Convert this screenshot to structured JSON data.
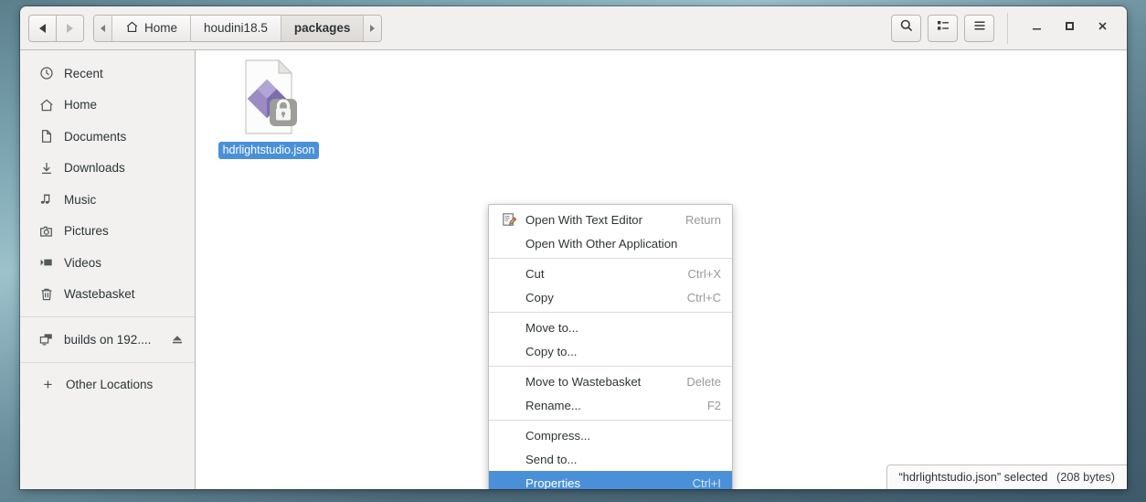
{
  "window": {
    "navigation": {
      "back_label": "Back",
      "back_enabled": "true",
      "forward_label": "Forward",
      "forward_enabled": "false"
    },
    "breadcrumb": {
      "left_arrow": "scroll-left",
      "right_arrow": "scroll-right",
      "items": [
        {
          "label": "Home",
          "icon": "home-icon",
          "current": "false"
        },
        {
          "label": "houdini18.5",
          "icon": "",
          "current": "false"
        },
        {
          "label": "packages",
          "icon": "",
          "current": "true"
        }
      ]
    },
    "toolbar_right": [
      {
        "name": "search-button",
        "icon": "search-icon"
      },
      {
        "name": "view-options-button",
        "icon": "list-view-icon"
      },
      {
        "name": "main-menu-button",
        "icon": "hamburger-icon"
      }
    ],
    "controls": [
      {
        "name": "minimize-button",
        "icon": "minimize-icon"
      },
      {
        "name": "maximize-button",
        "icon": "maximize-icon"
      },
      {
        "name": "close-button",
        "icon": "close-icon"
      }
    ]
  },
  "sidebar": {
    "items": [
      {
        "label": "Recent",
        "icon": "clock-icon"
      },
      {
        "label": "Home",
        "icon": "home-icon"
      },
      {
        "label": "Documents",
        "icon": "document-icon"
      },
      {
        "label": "Downloads",
        "icon": "download-icon"
      },
      {
        "label": "Music",
        "icon": "music-note-icon"
      },
      {
        "label": "Pictures",
        "icon": "camera-icon"
      },
      {
        "label": "Videos",
        "icon": "video-icon"
      },
      {
        "label": "Wastebasket",
        "icon": "trash-icon"
      }
    ],
    "mount": {
      "label": "builds on 192....",
      "icon": "network-drive-icon",
      "eject": "eject-icon"
    },
    "other_locations": {
      "label": "Other Locations",
      "icon": "plus-icon"
    }
  },
  "content": {
    "file": {
      "name": "hdrlightstudio.json",
      "icon": "json-file-icon",
      "badge": "lock-icon",
      "selected": "true"
    }
  },
  "context_menu": {
    "items": [
      {
        "label": "Open With Text Editor",
        "accel": "Return",
        "icon": "text-editor-icon",
        "selected": "false",
        "sep_after": "false"
      },
      {
        "label": "Open With Other Application",
        "accel": "",
        "icon": "",
        "selected": "false",
        "sep_after": "true"
      },
      {
        "label": "Cut",
        "accel": "Ctrl+X",
        "icon": "",
        "selected": "false",
        "sep_after": "false"
      },
      {
        "label": "Copy",
        "accel": "Ctrl+C",
        "icon": "",
        "selected": "false",
        "sep_after": "true"
      },
      {
        "label": "Move to...",
        "accel": "",
        "icon": "",
        "selected": "false",
        "sep_after": "false"
      },
      {
        "label": "Copy to...",
        "accel": "",
        "icon": "",
        "selected": "false",
        "sep_after": "true"
      },
      {
        "label": "Move to Wastebasket",
        "accel": "Delete",
        "icon": "",
        "selected": "false",
        "sep_after": "false"
      },
      {
        "label": "Rename...",
        "accel": "F2",
        "icon": "",
        "selected": "false",
        "sep_after": "true"
      },
      {
        "label": "Compress...",
        "accel": "",
        "icon": "",
        "selected": "false",
        "sep_after": "false"
      },
      {
        "label": "Send to...",
        "accel": "",
        "icon": "",
        "selected": "false",
        "sep_after": "false"
      },
      {
        "label": "Properties",
        "accel": "Ctrl+I",
        "icon": "",
        "selected": "true",
        "sep_after": "false"
      }
    ]
  },
  "status": {
    "selection": "“hdrlightstudio.json” selected",
    "size": "(208 bytes)"
  },
  "colors": {
    "accent": "#4a90d9",
    "headerbar": "#f1f0ef",
    "sidebar": "#f2f1f0",
    "content": "#ffffff",
    "text": "#2e3436",
    "dim_text": "#9a9996"
  }
}
